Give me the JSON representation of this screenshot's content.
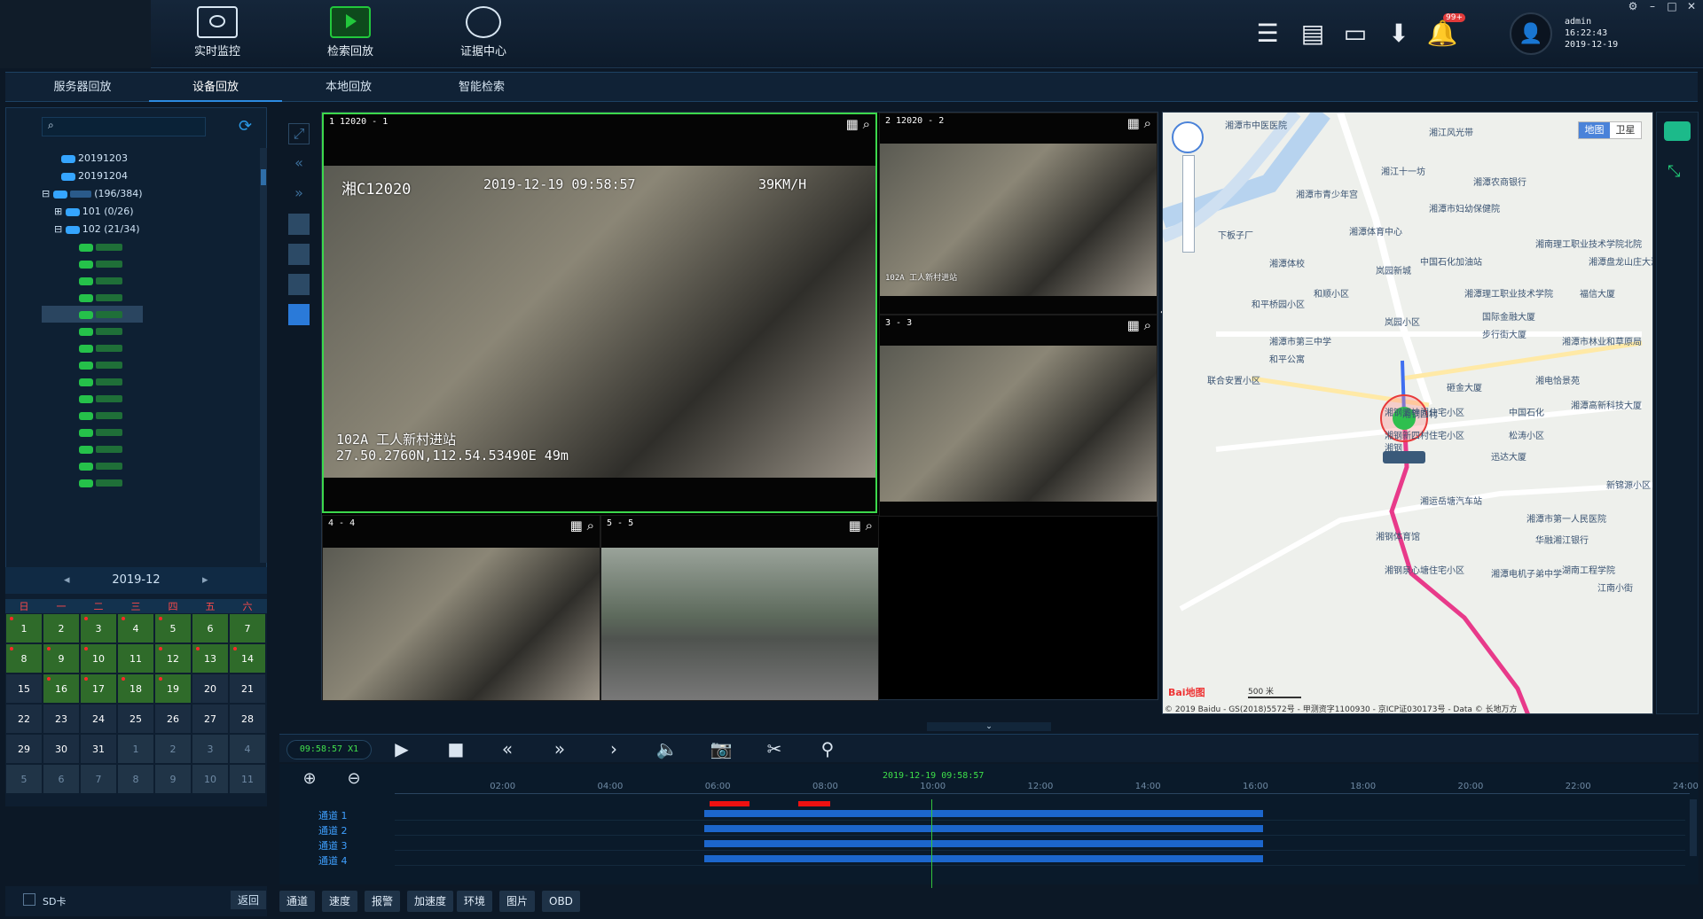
{
  "toolbar": {
    "items": [
      {
        "label": "实时监控",
        "icon": "monitor-eye-icon"
      },
      {
        "label": "检索回放",
        "icon": "playback-icon",
        "active": true
      },
      {
        "label": "证据中心",
        "icon": "evidence-search-icon"
      }
    ],
    "right_icons": [
      "list-icon",
      "document-icon",
      "inbox-icon",
      "download-icon",
      "bell-icon"
    ],
    "notification_badge": "99+",
    "user": {
      "name": "admin",
      "time": "16:22:43",
      "date": "2019-12-19"
    }
  },
  "tabs": [
    {
      "label": "服务器回放"
    },
    {
      "label": "设备回放",
      "active": true
    },
    {
      "label": "本地回放"
    },
    {
      "label": "智能检索"
    }
  ],
  "tree": {
    "dates": [
      "20191203",
      "20191204"
    ],
    "group_count": "(196/384)",
    "sub_nodes": [
      {
        "label": "101",
        "count": "(0/26)"
      },
      {
        "label": "102",
        "count": "(21/34)"
      }
    ]
  },
  "calendar": {
    "month": "2019-12",
    "weekdays": [
      "日",
      "一",
      "二",
      "三",
      "四",
      "五",
      "六"
    ],
    "days": [
      {
        "d": "1",
        "t": "has",
        "dot": true
      },
      {
        "d": "2",
        "t": "has"
      },
      {
        "d": "3",
        "t": "has",
        "dot": true
      },
      {
        "d": "4",
        "t": "has",
        "dot": true
      },
      {
        "d": "5",
        "t": "has",
        "dot": true
      },
      {
        "d": "6",
        "t": "has"
      },
      {
        "d": "7",
        "t": "has"
      },
      {
        "d": "8",
        "t": "has",
        "dot": true
      },
      {
        "d": "9",
        "t": "has",
        "dot": true
      },
      {
        "d": "10",
        "t": "has",
        "dot": true
      },
      {
        "d": "11",
        "t": "has"
      },
      {
        "d": "12",
        "t": "has",
        "dot": true
      },
      {
        "d": "13",
        "t": "has",
        "dot": true
      },
      {
        "d": "14",
        "t": "has",
        "dot": true
      },
      {
        "d": "15",
        "t": "cur"
      },
      {
        "d": "16",
        "t": "has",
        "dot": true
      },
      {
        "d": "17",
        "t": "has",
        "dot": true
      },
      {
        "d": "18",
        "t": "has",
        "dot": true
      },
      {
        "d": "19",
        "t": "has",
        "dot": true
      },
      {
        "d": "20",
        "t": "cur"
      },
      {
        "d": "21",
        "t": "cur"
      },
      {
        "d": "22",
        "t": "cur"
      },
      {
        "d": "23",
        "t": "cur"
      },
      {
        "d": "24",
        "t": "cur"
      },
      {
        "d": "25",
        "t": "cur"
      },
      {
        "d": "26",
        "t": "cur"
      },
      {
        "d": "27",
        "t": "cur"
      },
      {
        "d": "28",
        "t": "cur"
      },
      {
        "d": "29",
        "t": "cur"
      },
      {
        "d": "30",
        "t": "cur"
      },
      {
        "d": "31",
        "t": "cur"
      },
      {
        "d": "1",
        "t": "oth"
      },
      {
        "d": "2",
        "t": "oth"
      },
      {
        "d": "3",
        "t": "oth"
      },
      {
        "d": "4",
        "t": "oth"
      },
      {
        "d": "5",
        "t": "oth"
      },
      {
        "d": "6",
        "t": "oth"
      },
      {
        "d": "7",
        "t": "oth"
      },
      {
        "d": "8",
        "t": "oth"
      },
      {
        "d": "9",
        "t": "oth"
      },
      {
        "d": "10",
        "t": "oth"
      },
      {
        "d": "11",
        "t": "oth"
      }
    ]
  },
  "left_footer": {
    "sd_label": "SD卡",
    "back_label": "返回"
  },
  "channels": [
    {
      "id": "1",
      "title": "1  12020 - 1",
      "osd_plate": "湘C12020",
      "osd_time": "2019-12-19 09:58:57",
      "osd_speed": "39KM/H",
      "osd_station": "102A 工人新村进站",
      "osd_gps": "27.50.2760N,112.54.53490E 49m"
    },
    {
      "id": "2",
      "title": "2  12020 - 2",
      "osd_station": "102A 工人新村进站"
    },
    {
      "id": "3",
      "title": "3        - 3"
    },
    {
      "id": "4",
      "title": "4        - 4"
    },
    {
      "id": "5",
      "title": "5        - 5"
    }
  ],
  "map": {
    "labels": [
      "湘潭市中医医院",
      "湘江风光带",
      "湘江十一坊",
      "湘潭农商银行",
      "湘潭市青少年宫",
      "湘潭市妇幼保健院",
      "下板子厂",
      "湘潭体育中心",
      "湘潭体校",
      "岚园新城",
      "中国石化加油站",
      "湘南理工职业技术学院北院",
      "湘潭盘龙山庄大酒店",
      "和顺小区",
      "湘潭理工职业技术学院",
      "福信大厦",
      "和平桥园小区",
      "岚园小区",
      "国际金融大厦",
      "湘潭市第三中学",
      "步行街大厦",
      "和平公寓",
      "湘潭市林业和草原局",
      "联合安置小区",
      "砸金大厦",
      "湘钢四村",
      "湘电恰景苑",
      "湘钢泗神阁住宅小区",
      "中国石化",
      "湘潭高新科技大厦",
      "湘钢新四村住宅小区",
      "松涛小区",
      "湘钢",
      "迅达大厦",
      "湘运岳塘汽车站",
      "湘潭市第一人民医院",
      "华融湘江银行",
      "湘钢体育馆",
      "湘钢泉心塘住宅小区",
      "湘潭电机子弟中学",
      "湖南工程学院",
      "江南小街",
      "新锦源小区"
    ],
    "toggle": [
      "地图",
      "卫星"
    ],
    "scale": "500 米",
    "logo": "Bai地图",
    "copyright": "© 2019 Baidu - GS(2018)5572号 - 甲测资字1100930 - 京ICP证030173号 - Data © 长地万方"
  },
  "playback": {
    "time": "09:58:57",
    "speed": "X1",
    "cursor_label": "2019-12-19  09:58:57",
    "ticks": [
      "02:00",
      "04:00",
      "06:00",
      "08:00",
      "10:00",
      "12:00",
      "14:00",
      "16:00",
      "18:00",
      "20:00",
      "22:00",
      "24:00"
    ],
    "channels": [
      "通道 1",
      "通道 2",
      "通道 3",
      "通道 4"
    ],
    "record_start_h": 5.75,
    "record_end_h": 16.15,
    "cursor_h": 9.98
  },
  "bottom_tabs": [
    "通道",
    "速度",
    "报警",
    "加速度",
    "环境",
    "图片",
    "OBD"
  ]
}
